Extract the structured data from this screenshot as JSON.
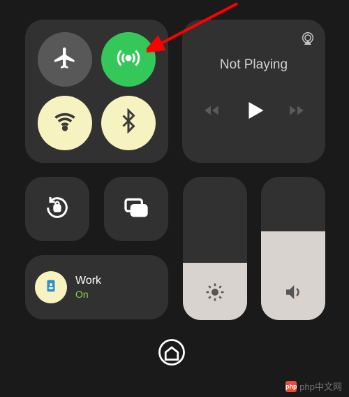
{
  "media": {
    "title": "Not Playing"
  },
  "focus": {
    "name": "Work",
    "status": "On"
  },
  "brightness": {
    "percent": 40
  },
  "volume": {
    "percent": 62
  },
  "watermark": {
    "text": "php中文网"
  },
  "icons": {
    "airplane": "airplane-icon",
    "cellular": "cellular-icon",
    "wifi": "wifi-icon",
    "bluetooth": "bluetooth-icon",
    "airplay": "airplay-icon",
    "back": "skip-back-icon",
    "play": "play-icon",
    "forward": "skip-forward-icon",
    "rotation": "rotation-lock-icon",
    "mirror": "screen-mirroring-icon",
    "sun": "brightness-icon",
    "speaker": "volume-icon",
    "badge": "id-badge-icon",
    "home": "home-icon"
  }
}
